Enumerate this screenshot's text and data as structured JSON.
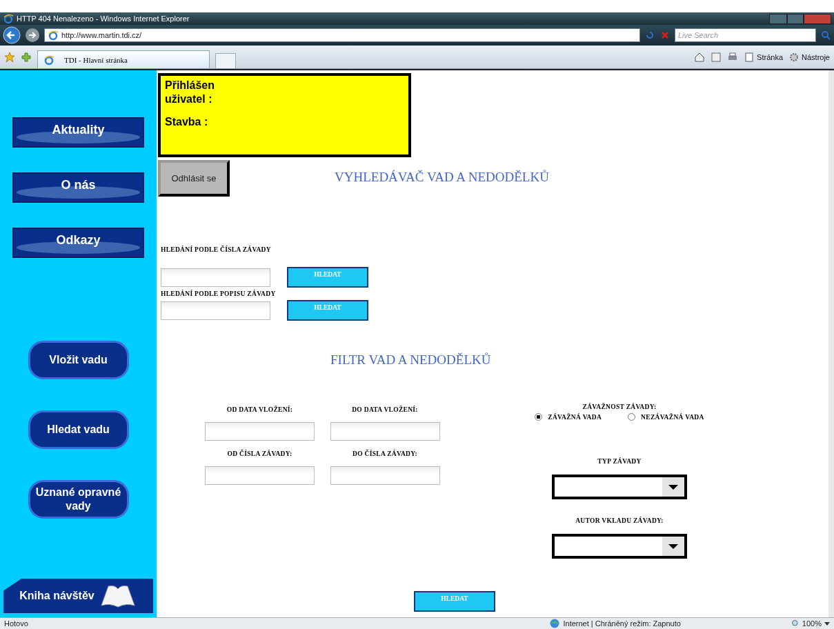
{
  "browser": {
    "title": "HTTP 404 Nenalezeno - Windows Internet Explorer",
    "address": "http://www.martin.tdi.cz/",
    "search_placeholder": "Live Search",
    "tab": "TDI - Hlavní stránka",
    "tools": [
      {
        "label": "Stránka"
      },
      {
        "label": "Nástroje"
      }
    ]
  },
  "sidebar": {
    "top_items": [
      "Aktuality",
      "O nás",
      "Odkazy"
    ],
    "action_items": [
      "Vložit vadu",
      "Hledat vadu",
      "Uznané opravné vady"
    ],
    "guestbook": "Kniha návštěv"
  },
  "user_box": {
    "user_label": "Přihlášen uživatel :",
    "site_label": "Stavba :"
  },
  "logout": "Odhlásit se",
  "search": {
    "title": "VYHLEDÁVAČ VAD A NEDODĚLKŮ",
    "rows": [
      {
        "label": "HLEDÁNÍ PODLE ČÍSLA ZÁVADY",
        "button": "HLEDAT"
      },
      {
        "label": "HLEDÁNÍ PODLE POPISU ZÁVADY",
        "button": "HLEDAT"
      }
    ]
  },
  "filter": {
    "title": "FILTR VAD A NEDODĚLKŮ",
    "fields": [
      {
        "label": "OD DATA VLOŽENÍ:"
      },
      {
        "label": "DO DATA VLOŽENÍ:"
      },
      {
        "label": "OD ČÍSLA ZÁVADY:"
      },
      {
        "label": "DO ČÍSLA ZÁVADY:"
      }
    ],
    "severity": {
      "label": "ZÁVAŽNOST ZÁVADY:",
      "options": [
        {
          "label": "ZÁVAŽNÁ VADA",
          "selected": true
        },
        {
          "label": "NEZÁVAŽNÁ VADA",
          "selected": false
        }
      ]
    },
    "selects": [
      {
        "label": "TYP ZÁVADY"
      },
      {
        "label": "AUTOR VKLADU ZÁVADY:"
      }
    ],
    "button": "HLEDAT"
  },
  "status_bar": {
    "text": "Hotovo",
    "zone": "Internet | Chráněný režim: Zapnuto",
    "zoom": "100%"
  }
}
